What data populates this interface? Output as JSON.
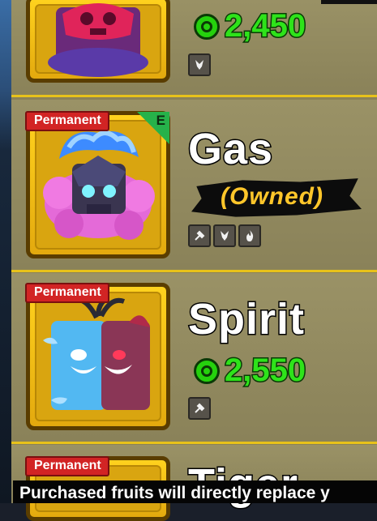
{
  "shop": {
    "items": [
      {
        "name": "",
        "price": "2,450",
        "abilities": [
          "fighting-style-icon"
        ]
      },
      {
        "name": "Gas",
        "tag": "Permanent",
        "rarity_badge": "E",
        "status": "(Owned)",
        "abilities": [
          "hammer-icon",
          "fighting-style-icon",
          "flame-icon"
        ]
      },
      {
        "name": "Spirit",
        "tag": "Permanent",
        "price": "2,550",
        "abilities": [
          "hammer-icon"
        ]
      },
      {
        "name": "Tiger",
        "tag": "Permanent"
      }
    ],
    "footer_notice": "Purchased fruits will directly replace y"
  },
  "colors": {
    "frame_gold": "#e8c21a",
    "card_gold": "#ffd21e",
    "price_green": "#2ee31a",
    "permanent_red": "#d22424",
    "owned_yellow": "#ffc62a"
  }
}
